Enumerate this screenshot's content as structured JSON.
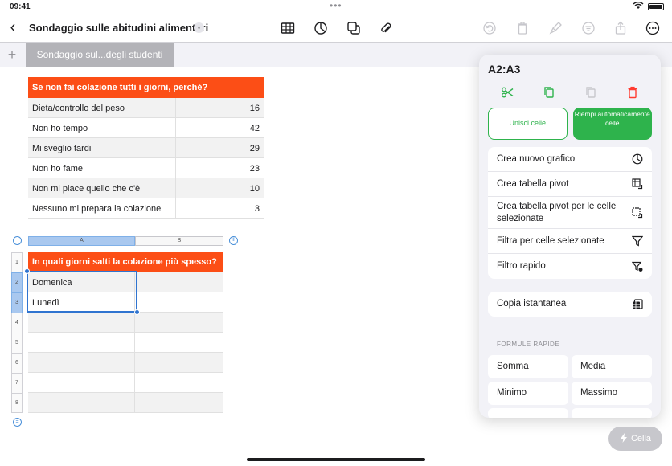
{
  "status": {
    "time": "09:41",
    "dots": "•••"
  },
  "toolbar": {
    "back": "‹",
    "title": "Sondaggio sulle abitudini alimentari",
    "title_chevron": "⌄",
    "icons": [
      "table-icon",
      "chart-icon",
      "shapes-icon",
      "attachment-icon",
      "undo-icon",
      "trash-icon",
      "paintbrush-icon",
      "format-icon",
      "share-icon",
      "more-icon"
    ]
  },
  "sheets": {
    "add": "+",
    "active_tab": "Sondaggio sul...degli studenti"
  },
  "table1": {
    "header": "Se non fai colazione tutti i giorni, perché?",
    "rows": [
      {
        "label": "Dieta/controllo del peso",
        "value": "16"
      },
      {
        "label": "Non ho tempo",
        "value": "42"
      },
      {
        "label": "Mi sveglio tardi",
        "value": "29"
      },
      {
        "label": "Non ho fame",
        "value": "23"
      },
      {
        "label": "Non mi piace quello che c'è",
        "value": "10"
      },
      {
        "label": "Nessuno mi prepara la colazione",
        "value": "3"
      }
    ]
  },
  "table2": {
    "columns": [
      "A",
      "B"
    ],
    "row_numbers": [
      "1",
      "2",
      "3",
      "4",
      "5",
      "6",
      "7",
      "8"
    ],
    "header": "In quali giorni salti la colazione più spesso?",
    "rows": [
      "Domenica",
      "Lunedì",
      "",
      "",
      "",
      "",
      ""
    ]
  },
  "popover": {
    "title": "A2:A3",
    "merge_label": "Unisci celle",
    "fill_label": "Riempi automaticamente celle",
    "group1": [
      {
        "label": "Crea nuovo grafico",
        "icon": "chart-icon"
      },
      {
        "label": "Crea tabella pivot",
        "icon": "pivot-table-icon"
      },
      {
        "label": "Crea tabella pivot per le celle selezionate",
        "icon": "pivot-selection-icon"
      },
      {
        "label": "Filtra per celle selezionate",
        "icon": "filter-icon"
      },
      {
        "label": "Filtro rapido",
        "icon": "quick-filter-icon"
      }
    ],
    "snapshot_label": "Copia istantanea",
    "formulas_label": "FORMULE RAPIDE",
    "formulas": [
      "Somma",
      "Media",
      "Minimo",
      "Massimo"
    ]
  },
  "cella": {
    "label": "Cella"
  },
  "colors": {
    "accent_orange": "#fc4e16",
    "green": "#2eb34c",
    "selection_blue": "#2f74d0",
    "destructive": "#ff3b30"
  }
}
